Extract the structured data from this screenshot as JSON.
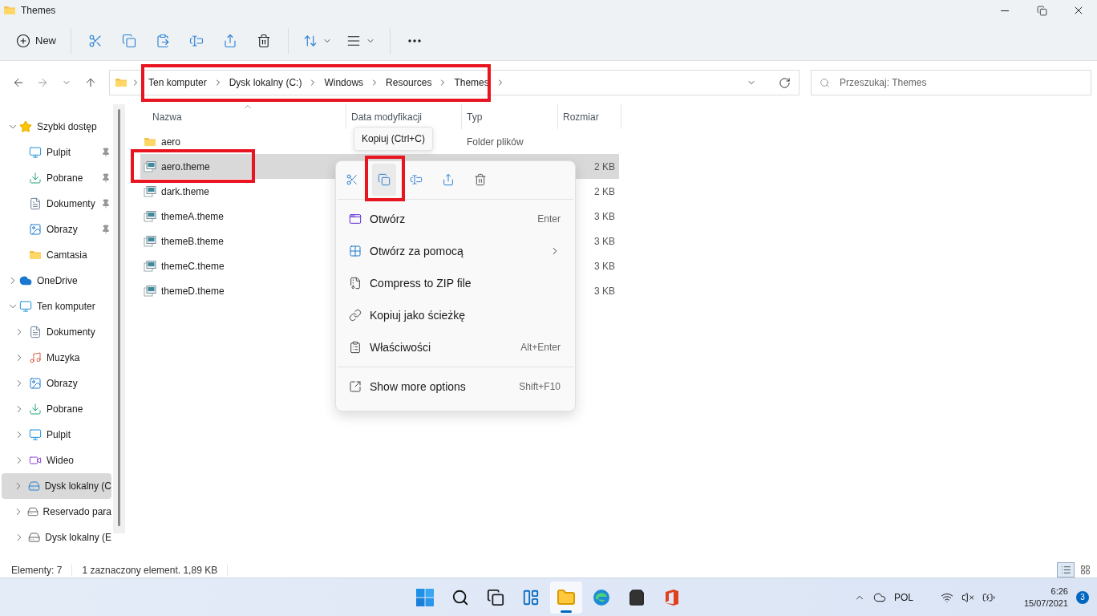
{
  "window": {
    "title": "Themes"
  },
  "toolbar": {
    "new_label": "New"
  },
  "address": {
    "crumbs": [
      "Ten komputer",
      "Dysk lokalny (C:)",
      "Windows",
      "Resources",
      "Themes"
    ],
    "highlighted": true
  },
  "search": {
    "placeholder": "Przeszukaj: Themes"
  },
  "sidebar": {
    "items": [
      {
        "label": "Szybki dostęp",
        "kind": "star",
        "expanded": true,
        "selected": false,
        "children": [
          {
            "label": "Pulpit",
            "kind": "desktop",
            "pinned": true,
            "selected": false
          },
          {
            "label": "Pobrane",
            "kind": "download",
            "pinned": true,
            "selected": false
          },
          {
            "label": "Dokumenty",
            "kind": "document",
            "pinned": true,
            "selected": false
          },
          {
            "label": "Obrazy",
            "kind": "pictures",
            "pinned": true,
            "selected": false
          },
          {
            "label": "Camtasia",
            "kind": "folder",
            "pinned": false,
            "selected": false
          }
        ]
      },
      {
        "label": "OneDrive",
        "kind": "cloud",
        "expanded": false,
        "selected": false
      },
      {
        "label": "Ten komputer",
        "kind": "computer",
        "expanded": true,
        "selected": false,
        "children": [
          {
            "label": "Dokumenty",
            "kind": "document",
            "expanded": false,
            "selected": false
          },
          {
            "label": "Muzyka",
            "kind": "music",
            "expanded": false,
            "selected": false
          },
          {
            "label": "Obrazy",
            "kind": "pictures",
            "expanded": false,
            "selected": false
          },
          {
            "label": "Pobrane",
            "kind": "download",
            "expanded": false,
            "selected": false
          },
          {
            "label": "Pulpit",
            "kind": "desktop",
            "expanded": false,
            "selected": false
          },
          {
            "label": "Wideo",
            "kind": "video",
            "expanded": false,
            "selected": false
          },
          {
            "label": "Dysk lokalny (C",
            "kind": "system-drive",
            "expanded": false,
            "selected": true
          },
          {
            "label": "Reservado para",
            "kind": "drive",
            "expanded": false,
            "selected": false
          },
          {
            "label": "Dysk lokalny (E",
            "kind": "drive",
            "expanded": false,
            "selected": false
          }
        ]
      }
    ]
  },
  "file_list": {
    "columns": [
      {
        "label": "Nazwa",
        "sorted": true
      },
      {
        "label": "Data modyfikacji",
        "sorted": false
      },
      {
        "label": "Typ",
        "sorted": false
      },
      {
        "label": "Rozmiar",
        "sorted": false
      }
    ],
    "rows": [
      {
        "name": "aero",
        "kind": "folder",
        "type": "Folder plików",
        "selected": false,
        "highlighted": false
      },
      {
        "name": "aero.theme",
        "kind": "theme",
        "size": "2 KB",
        "selected": true,
        "highlighted": true
      },
      {
        "name": "dark.theme",
        "kind": "theme",
        "size": "2 KB",
        "selected": false,
        "highlighted": false
      },
      {
        "name": "themeA.theme",
        "kind": "theme",
        "size": "3 KB",
        "selected": false,
        "highlighted": false
      },
      {
        "name": "themeB.theme",
        "kind": "theme",
        "size": "3 KB",
        "selected": false,
        "highlighted": false
      },
      {
        "name": "themeC.theme",
        "kind": "theme",
        "size": "3 KB",
        "selected": false,
        "highlighted": false
      },
      {
        "name": "themeD.theme",
        "kind": "theme",
        "size": "3 KB",
        "selected": false,
        "highlighted": false
      }
    ]
  },
  "tooltip": {
    "text": "Kopiuj (Ctrl+C)"
  },
  "context_menu": {
    "actions": [
      {
        "kind": "cut",
        "hovered": false,
        "highlighted": false
      },
      {
        "kind": "copy",
        "hovered": true,
        "highlighted": true
      },
      {
        "kind": "rename",
        "hovered": false,
        "highlighted": false
      },
      {
        "kind": "share",
        "hovered": false,
        "highlighted": false
      },
      {
        "kind": "delete",
        "hovered": false,
        "highlighted": false
      }
    ],
    "groups": [
      [
        {
          "label": "Otwórz",
          "kind": "open",
          "shortcut": "Enter",
          "submenu": false
        },
        {
          "label": "Otwórz za pomocą",
          "kind": "open-with",
          "submenu": true
        },
        {
          "label": "Compress to ZIP file",
          "kind": "zip",
          "submenu": false
        },
        {
          "label": "Kopiuj jako ścieżkę",
          "kind": "copy-path",
          "submenu": false
        },
        {
          "label": "Właściwości",
          "kind": "properties",
          "shortcut": "Alt+Enter",
          "submenu": false
        }
      ],
      [
        {
          "label": "Show more options",
          "kind": "more",
          "shortcut": "Shift+F10",
          "submenu": false
        }
      ]
    ]
  },
  "status_bar": {
    "count": "Elementy: 7",
    "selection": "1 zaznaczony element. 1,89 KB",
    "views": [
      {
        "kind": "details",
        "selected": true
      },
      {
        "kind": "tiles",
        "selected": false
      }
    ]
  },
  "taskbar": {
    "apps": [
      {
        "kind": "start",
        "active": false
      },
      {
        "kind": "search",
        "active": false
      },
      {
        "kind": "task-view",
        "active": false
      },
      {
        "kind": "widgets",
        "active": false
      },
      {
        "kind": "explorer",
        "active": true
      },
      {
        "kind": "browser",
        "active": false
      },
      {
        "kind": "store",
        "active": false
      },
      {
        "kind": "office",
        "active": false
      }
    ],
    "tray": {
      "language": "POL",
      "time": "6:26",
      "date": "15/07/2021",
      "notifications": "3"
    }
  }
}
